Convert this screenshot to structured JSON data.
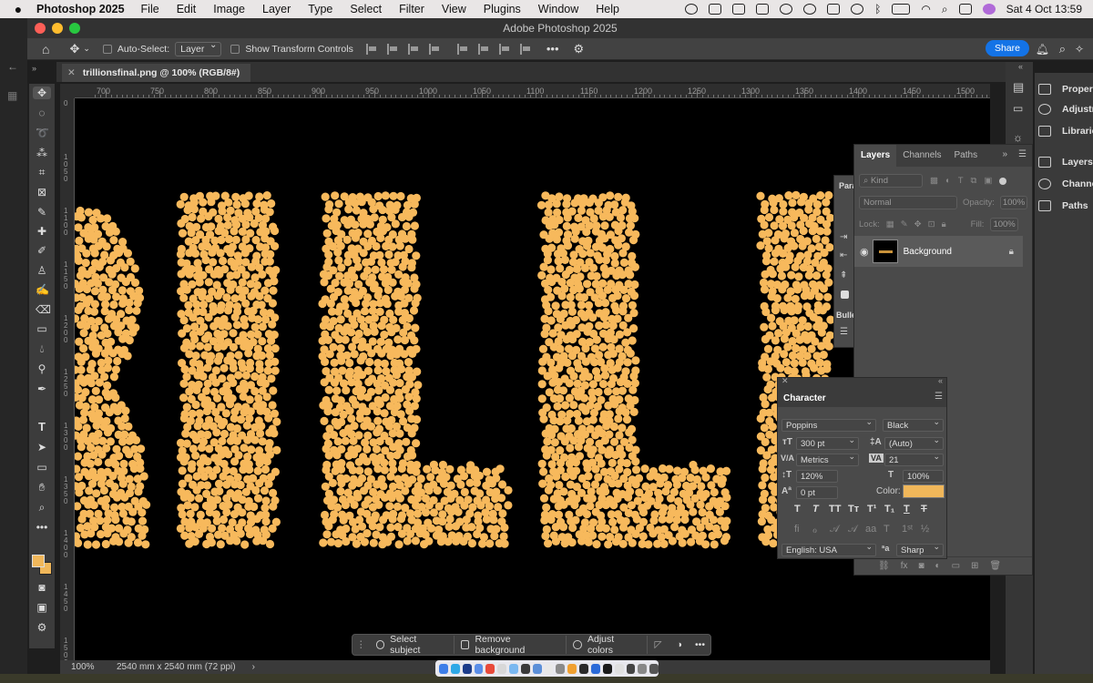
{
  "menubar": {
    "app_name": "Photoshop 2025",
    "items": [
      "File",
      "Edit",
      "Image",
      "Layer",
      "Type",
      "Select",
      "Filter",
      "View",
      "Plugins",
      "Window",
      "Help"
    ],
    "datetime": "Sat 4 Oct  13:59"
  },
  "window": {
    "title": "Adobe Photoshop 2025"
  },
  "options_bar": {
    "auto_select_label": "Auto-Select:",
    "auto_select_value": "Layer",
    "transform_label": "Show Transform Controls",
    "share_label": "Share"
  },
  "document": {
    "tab_title": "trillionsfinal.png @ 100% (RGB/8#)",
    "zoom": "100%",
    "dimensions": "2540 mm x 2540 mm (72 ppi)"
  },
  "ruler": {
    "h_ticks": [
      "700",
      "750",
      "800",
      "850",
      "900",
      "950",
      "1000",
      "1050",
      "1100",
      "1150",
      "1200",
      "1250",
      "1300",
      "1350",
      "1400",
      "1450",
      "1500"
    ],
    "v_ticks": [
      "0",
      "1050",
      "1100",
      "1150",
      "1200",
      "1250",
      "1300",
      "1350",
      "1400",
      "1450",
      "1500"
    ]
  },
  "taskbar": {
    "select_subject": "Select subject",
    "remove_background": "Remove background",
    "adjust_colors": "Adjust colors"
  },
  "right_dock": {
    "items": [
      "Properties",
      "Adjustments",
      "Libraries",
      "Layers",
      "Channels",
      "Paths"
    ]
  },
  "paragraph_peek": {
    "tab": "Para",
    "section": "Bulle"
  },
  "layers_panel": {
    "tabs": [
      "Layers",
      "Channels",
      "Paths"
    ],
    "kind_placeholder": "Kind",
    "blend_mode": "Normal",
    "opacity_label": "Opacity:",
    "opacity_value": "100%",
    "lock_label": "Lock:",
    "fill_label": "Fill:",
    "fill_value": "100%",
    "layer_name": "Background"
  },
  "character_panel": {
    "title": "Character",
    "font_family": "Poppins",
    "font_style": "Black",
    "size": "300 pt",
    "leading": "(Auto)",
    "kerning": "Metrics",
    "tracking": "21",
    "vertical_scale": "120%",
    "horizontal_scale": "100%",
    "baseline_shift": "0 pt",
    "color_label": "Color:",
    "color": "#f0b75a",
    "language": "English: USA",
    "antialias": "Sharp"
  },
  "colors": {
    "dot_color": "#f7b95c",
    "accent_blue": "#1473e6"
  }
}
